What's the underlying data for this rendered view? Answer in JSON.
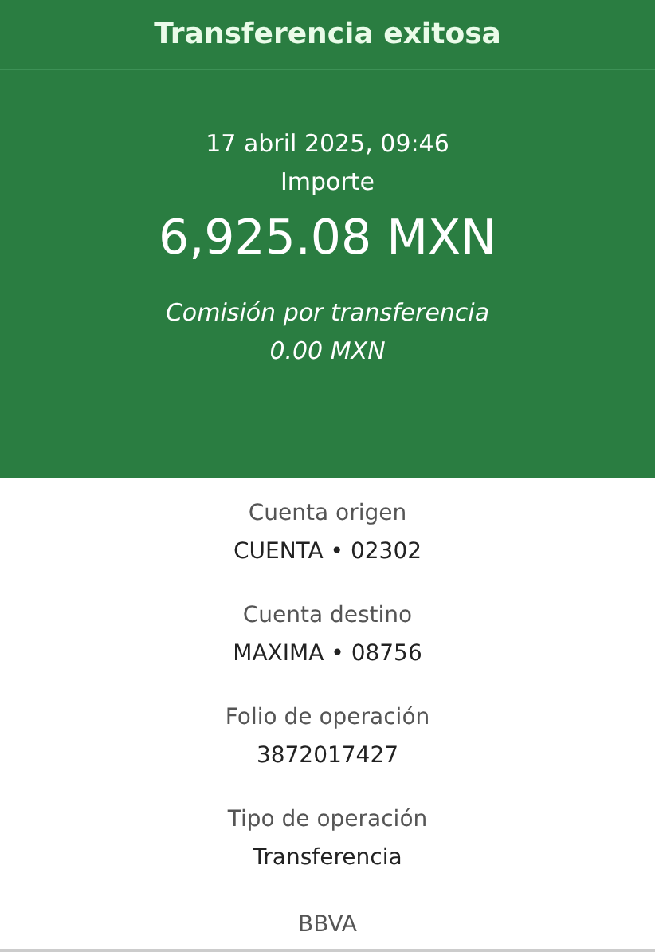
{
  "header": {
    "title": "Transferencia exitosa"
  },
  "summary": {
    "datetime": "17 abril 2025, 09:46",
    "amount_label": "Importe",
    "amount": "6,925.08 MXN",
    "fee_label": "Comisión por transferencia",
    "fee": "0.00 MXN"
  },
  "details": [
    {
      "label": "Cuenta origen",
      "value": "CUENTA • 02302"
    },
    {
      "label": "Cuenta destino",
      "value": "MAXIMA • 08756"
    },
    {
      "label": "Folio de operación",
      "value": "3872017427"
    },
    {
      "label": "Tipo de operación",
      "value": "Transferencia"
    }
  ],
  "bank": "BBVA"
}
